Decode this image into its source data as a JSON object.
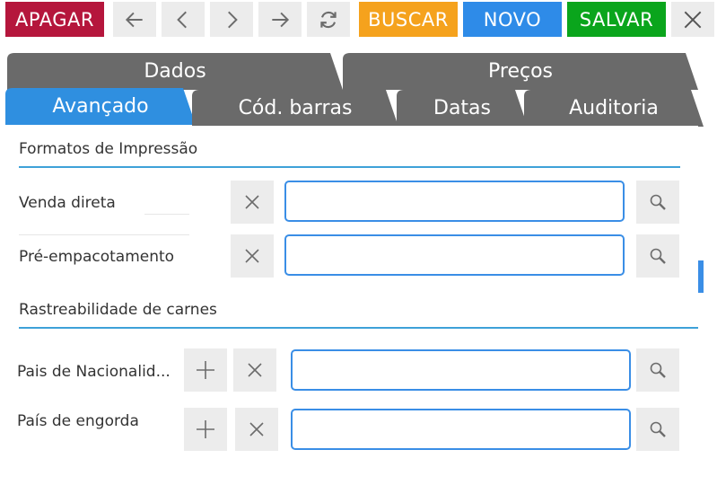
{
  "toolbar": {
    "delete_label": "APAGAR",
    "search_label": "BUSCAR",
    "new_label": "NOVO",
    "save_label": "SALVAR",
    "colors": {
      "delete": "#b5163c",
      "search": "#f5a21d",
      "new": "#2e8be8",
      "save": "#0aa51c",
      "nav": "#ececec"
    },
    "icons": [
      "arrow-left-icon",
      "chevron-left-icon",
      "chevron-right-icon",
      "arrow-right-icon",
      "refresh-icon",
      "close-icon"
    ]
  },
  "tabs": {
    "row1": [
      "Dados",
      "Preços"
    ],
    "row2": [
      "Avançado",
      "Cód. barras",
      "Datas",
      "Auditoria"
    ],
    "active": "Avançado",
    "colors": {
      "active": "#2f8fe0",
      "inactive": "#6a6a6a"
    }
  },
  "sections": {
    "print_formats": {
      "title": "Formatos de Impressão",
      "fields": [
        {
          "label": "Venda direta",
          "value": ""
        },
        {
          "label": "Pré-empacotamento",
          "value": ""
        }
      ]
    },
    "meat_traceability": {
      "title": "Rastreabilidade de carnes",
      "fields": [
        {
          "label": "Pais de Nacionalid...",
          "value": ""
        },
        {
          "label": "País de engorda",
          "value": ""
        }
      ]
    }
  }
}
